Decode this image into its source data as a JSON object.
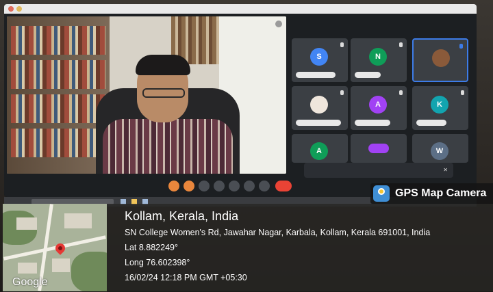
{
  "gps_overlay": {
    "brand": "GPS Map Camera",
    "location_title": "Kollam, Kerala, India",
    "address": "SN College Women's Rd, Jawahar Nagar, Karbala, Kollam, Kerala 691001, India",
    "latitude": "Lat 8.882249°",
    "longitude": "Long 76.602398°",
    "datetime": "16/02/24 12:18 PM GMT +05:30",
    "map_provider": "Google"
  },
  "meeting": {
    "participant_initials": [
      "S",
      "N",
      "",
      "",
      "A",
      "K",
      "A",
      "",
      "W"
    ]
  },
  "colors": {
    "avatar_blue": "#4285f4",
    "avatar_green": "#0f9d58",
    "avatar_purple": "#a142f4",
    "avatar_teal": "#12a4af",
    "end_call_red": "#ea4335",
    "active_border": "#3d7ce8"
  }
}
